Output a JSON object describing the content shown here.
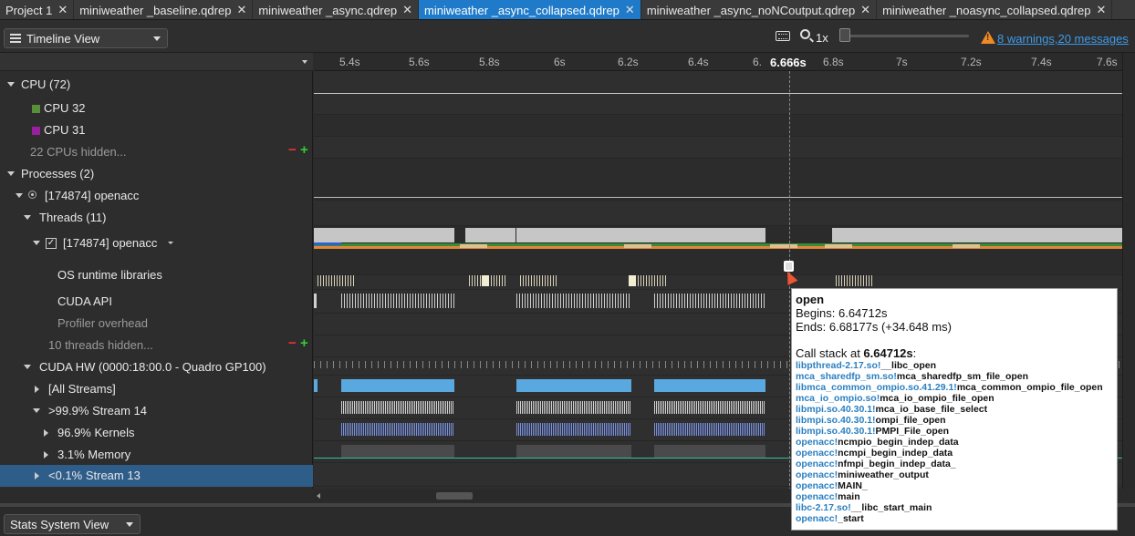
{
  "tabs": [
    {
      "label": "Project 1",
      "closable": true,
      "active": false
    },
    {
      "label": "miniweather _baseline.qdrep",
      "closable": true,
      "active": false
    },
    {
      "label": "miniweather _async.qdrep",
      "closable": true,
      "active": false
    },
    {
      "label": "miniweather _async_collapsed.qdrep",
      "closable": true,
      "active": true
    },
    {
      "label": "miniweather _async_noNCoutput.qdrep",
      "closable": true,
      "active": false
    },
    {
      "label": "miniweather _noasync_collapsed.qdrep",
      "closable": true,
      "active": false
    }
  ],
  "toolbar": {
    "view_select": "Timeline View",
    "zoom_label": "1x",
    "warnings_link": "8 warnings,20 messages",
    "accent": "#1f7bc9",
    "warn_color": "#f08a24"
  },
  "ruler": {
    "ticks": [
      "5.4s",
      "5.6s",
      "5.8s",
      "6s",
      "6.2s",
      "6.4s",
      "6.",
      "6.666s",
      "6.8s",
      "7s",
      "7.2s",
      "7.4s",
      "7.6s"
    ],
    "cursor": "6.666s"
  },
  "tree": {
    "cpu": "CPU (72)",
    "cpu32": "CPU 32",
    "cpu31": "CPU 31",
    "cpus_hidden": "22 CPUs hidden...",
    "processes": "Processes (2)",
    "process": "[174874] openacc",
    "threads": "Threads (11)",
    "thread": "[174874] openacc",
    "os_runtime": "OS runtime libraries",
    "cuda_api": "CUDA API",
    "profiler": "Profiler overhead",
    "threads_hidden": "10 threads hidden...",
    "cuda_hw": "CUDA HW (0000:18:00.0 - Quadro GP100)",
    "all_streams": "[All Streams]",
    "stream14": ">99.9% Stream 14",
    "kernels": "96.9% Kernels",
    "memory": "3.1% Memory",
    "stream13": "<0.1% Stream 13",
    "cpu32_color": "#5a8f3a",
    "cpu31_color": "#9a1fa0"
  },
  "bottom": {
    "view_select": "Stats System View"
  },
  "tooltip": {
    "title": "open",
    "begins": "Begins: 6.64712s",
    "ends": "Ends: 6.68177s (+34.648 ms)",
    "callstack_prefix": "Call stack at ",
    "callstack_time": "6.64712s",
    "callstack_suffix": ":",
    "stack": [
      {
        "lib": "libpthread-2.17.so!",
        "fn": "__libc_open"
      },
      {
        "lib": "mca_sharedfp_sm.so!",
        "fn": "mca_sharedfp_sm_file_open"
      },
      {
        "lib": "libmca_common_ompio.so.41.29.1!",
        "fn": "mca_common_ompio_file_open"
      },
      {
        "lib": "mca_io_ompio.so!",
        "fn": "mca_io_ompio_file_open"
      },
      {
        "lib": "libmpi.so.40.30.1!",
        "fn": "mca_io_base_file_select"
      },
      {
        "lib": "libmpi.so.40.30.1!",
        "fn": "ompi_file_open"
      },
      {
        "lib": "libmpi.so.40.30.1!",
        "fn": "PMPI_File_open"
      },
      {
        "lib": "openacc!",
        "fn": "ncmpio_begin_indep_data"
      },
      {
        "lib": "openacc!",
        "fn": "ncmpi_begin_indep_data"
      },
      {
        "lib": "openacc!",
        "fn": "nfmpi_begin_indep_data_"
      },
      {
        "lib": "openacc!",
        "fn": "miniweather_output"
      },
      {
        "lib": "openacc!",
        "fn": "MAIN_"
      },
      {
        "lib": "openacc!",
        "fn": "main"
      },
      {
        "lib": "libc-2.17.so!",
        "fn": "__libc_start_main"
      },
      {
        "lib": "openacc!",
        "fn": "_start"
      }
    ]
  }
}
